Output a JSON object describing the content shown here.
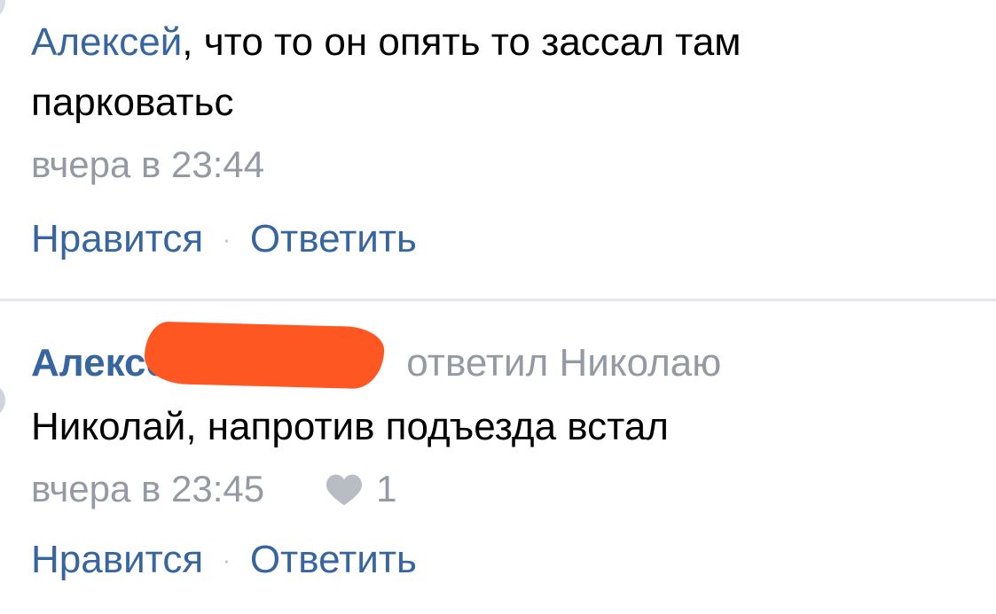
{
  "comments": [
    {
      "mention": "Алексей",
      "text": ", что то он опять то зассал там парковатьс",
      "timestamp": "вчера в 23:44",
      "like_label": "Нравится",
      "separator": "·",
      "reply_label": "Ответить"
    },
    {
      "author": "Алексей",
      "replied_to": "ответил Николаю",
      "text": "Николай, напротив подъезда встал",
      "timestamp": "вчера в 23:45",
      "like_count": "1",
      "like_label": "Нравится",
      "separator": "·",
      "reply_label": "Ответить"
    }
  ],
  "colors": {
    "link": "#36659f",
    "meta": "#939aa3",
    "redaction": "#ff5722",
    "divider": "#e3e6ea"
  }
}
